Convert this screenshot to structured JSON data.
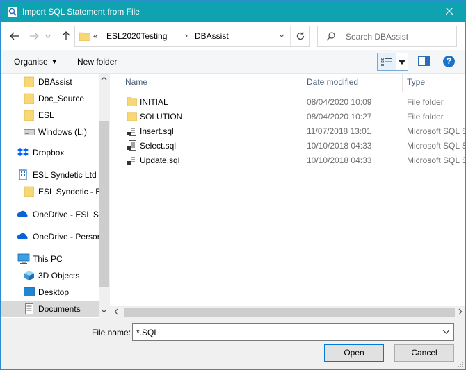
{
  "window": {
    "title": "Import SQL Statement from File"
  },
  "address": {
    "overflow": "«",
    "crumbs": [
      "ESL2020Testing",
      "DBAssist"
    ],
    "separator": "›"
  },
  "search": {
    "placeholder": "Search DBAssist"
  },
  "toolbar": {
    "organise": "Organise",
    "new_folder": "New folder",
    "help": "?"
  },
  "tree": [
    {
      "label": "DBAssist",
      "icon": "folder-icon"
    },
    {
      "label": "Doc_Source",
      "icon": "folder-icon"
    },
    {
      "label": "ESL",
      "icon": "folder-icon"
    },
    {
      "label": "Windows (L:)",
      "icon": "drive-icon"
    },
    {
      "label": "Dropbox",
      "icon": "dropbox-icon"
    },
    {
      "label": "ESL Syndetic Ltd",
      "icon": "building-icon"
    },
    {
      "label": "ESL Syndetic - ES",
      "icon": "folder-icon"
    },
    {
      "label": "OneDrive - ESL Sy",
      "icon": "onedrive-icon"
    },
    {
      "label": "OneDrive - Persor",
      "icon": "onedrive-icon"
    },
    {
      "label": "This PC",
      "icon": "computer-icon"
    },
    {
      "label": "3D Objects",
      "icon": "cube-icon"
    },
    {
      "label": "Desktop",
      "icon": "desktop-icon"
    },
    {
      "label": "Documents",
      "icon": "documents-icon",
      "selected": true
    }
  ],
  "columns": {
    "name": "Name",
    "date": "Date modified",
    "type": "Type"
  },
  "files": [
    {
      "name": "INITIAL",
      "date": "08/04/2020 10:09",
      "type": "File folder",
      "icon": "folder-icon"
    },
    {
      "name": "SOLUTION",
      "date": "08/04/2020 10:27",
      "type": "File folder",
      "icon": "folder-icon"
    },
    {
      "name": "Insert.sql",
      "date": "11/07/2018 13:01",
      "type": "Microsoft SQL Se",
      "icon": "sql-file-icon"
    },
    {
      "name": "Select.sql",
      "date": "10/10/2018 04:33",
      "type": "Microsoft SQL Se",
      "icon": "sql-file-icon"
    },
    {
      "name": "Update.sql",
      "date": "10/10/2018 04:33",
      "type": "Microsoft SQL Se",
      "icon": "sql-file-icon"
    }
  ],
  "filename": {
    "label": "File name:",
    "value": "*.SQL"
  },
  "buttons": {
    "open": "Open",
    "cancel": "Cancel"
  }
}
